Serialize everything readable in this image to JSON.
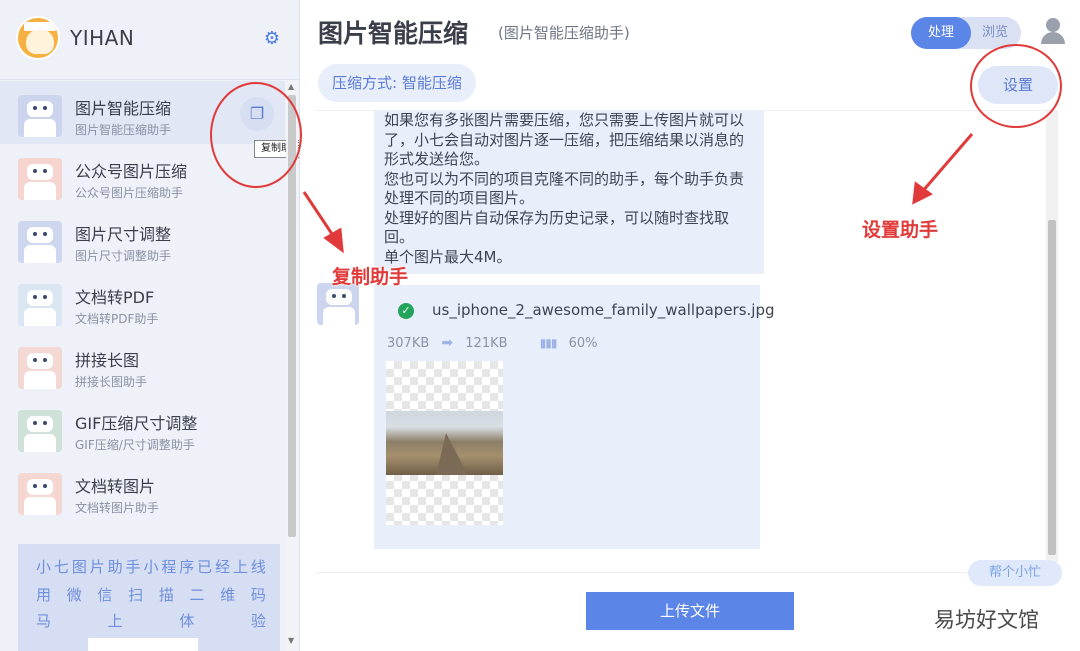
{
  "sidebar": {
    "brand_name": "YIHAN",
    "items": [
      {
        "title": "图片智能压缩",
        "subtitle": "图片智能压缩助手"
      },
      {
        "title": "公众号图片压缩",
        "subtitle": "公众号图片压缩助手"
      },
      {
        "title": "图片尺寸调整",
        "subtitle": "图片尺寸调整助手"
      },
      {
        "title": "文档转PDF",
        "subtitle": "文档转PDF助手"
      },
      {
        "title": "拼接长图",
        "subtitle": "拼接长图助手"
      },
      {
        "title": "GIF压缩尺寸调整",
        "subtitle": "GIF压缩/尺寸调整助手"
      },
      {
        "title": "文档转图片",
        "subtitle": "文档转图片助手"
      }
    ],
    "copy_tooltip": "复制助手",
    "promo": {
      "line1": [
        "小",
        "七",
        "图",
        "片",
        "助",
        "手",
        "小",
        "程",
        "序",
        "已",
        "经",
        "上",
        "线"
      ],
      "line2": [
        "用",
        "微",
        "信",
        "扫",
        "描",
        "二",
        "维",
        "码"
      ],
      "line3": [
        "马",
        "上",
        "体",
        "验"
      ]
    }
  },
  "header": {
    "title": "图片智能压缩",
    "subtitle": "(图片智能压缩助手)",
    "toggle_on": "处理",
    "toggle_off": "浏览",
    "mode_label": "压缩方式: 智能压缩",
    "settings_label": "设置"
  },
  "chat": {
    "intro_lines": [
      "如果您有多张图片需要压缩，您只需要上传图片就可以",
      "了，小七会自动对图片逐一压缩，把压缩结果以消息的",
      "形式发送给您。",
      "您也可以为不同的项目克隆不同的助手，每个助手负责",
      "处理不同的项目图片。",
      "处理好的图片自动保存为历史记录，可以随时查找取",
      "回。",
      "单个图片最大4M。"
    ],
    "file": {
      "name": "us_iphone_2_awesome_family_wallpapers.jpg",
      "original_size": "307KB",
      "compressed_size": "121KB",
      "ratio": "60%"
    }
  },
  "footer": {
    "upload_label": "上传文件",
    "help_label": "帮个小忙"
  },
  "annotations": {
    "copy_label": "复制助手",
    "settings_label": "设置助手",
    "color": "#e03a3a"
  },
  "watermark": "易坊好文馆",
  "colors": {
    "accent": "#5c85e8",
    "sidebar_bg": "#eef1f8",
    "bubble_bg": "#e9eefb",
    "success": "#23a45b"
  },
  "icons": {
    "settings": "gear-icon",
    "copy": "copy-icon",
    "user": "user-icon",
    "check": "check-circle-icon",
    "arrow": "arrow-right-icon",
    "ratio": "compress-ratio-icon"
  }
}
